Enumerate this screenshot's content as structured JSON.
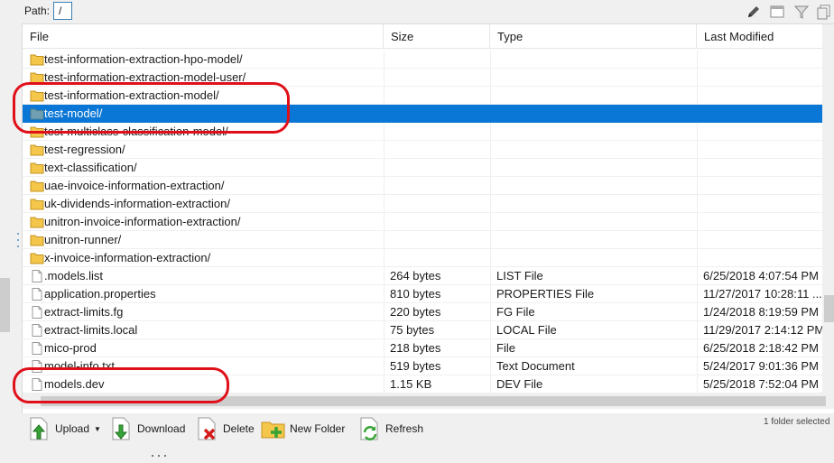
{
  "path_bar": {
    "label": "Path:",
    "value": "/",
    "icons": [
      "pencil-icon",
      "window-icon",
      "filter-icon",
      "copy-icon"
    ]
  },
  "columns": [
    "File",
    "Size",
    "Type",
    "Last Modified"
  ],
  "rows": [
    {
      "name": "test-information-extraction-hpo-model/",
      "size": "",
      "type": "",
      "modified": "",
      "kind": "folder",
      "selected": false
    },
    {
      "name": "test-information-extraction-model-user/",
      "size": "",
      "type": "",
      "modified": "",
      "kind": "folder",
      "selected": false
    },
    {
      "name": "test-information-extraction-model/",
      "size": "",
      "type": "",
      "modified": "",
      "kind": "folder",
      "selected": false
    },
    {
      "name": "test-model/",
      "size": "",
      "type": "",
      "modified": "",
      "kind": "folder",
      "selected": true
    },
    {
      "name": "test-multiclass-classification-model/",
      "size": "",
      "type": "",
      "modified": "",
      "kind": "folder",
      "selected": false
    },
    {
      "name": "test-regression/",
      "size": "",
      "type": "",
      "modified": "",
      "kind": "folder",
      "selected": false
    },
    {
      "name": "text-classification/",
      "size": "",
      "type": "",
      "modified": "",
      "kind": "folder",
      "selected": false
    },
    {
      "name": "uae-invoice-information-extraction/",
      "size": "",
      "type": "",
      "modified": "",
      "kind": "folder",
      "selected": false
    },
    {
      "name": "uk-dividends-information-extraction/",
      "size": "",
      "type": "",
      "modified": "",
      "kind": "folder",
      "selected": false
    },
    {
      "name": "unitron-invoice-information-extraction/",
      "size": "",
      "type": "",
      "modified": "",
      "kind": "folder",
      "selected": false
    },
    {
      "name": "unitron-runner/",
      "size": "",
      "type": "",
      "modified": "",
      "kind": "folder",
      "selected": false
    },
    {
      "name": "x-invoice-information-extraction/",
      "size": "",
      "type": "",
      "modified": "",
      "kind": "folder",
      "selected": false
    },
    {
      "name": ".models.list",
      "size": "264 bytes",
      "type": "LIST File",
      "modified": "6/25/2018 4:07:54 PM",
      "kind": "file",
      "selected": false
    },
    {
      "name": "application.properties",
      "size": "810 bytes",
      "type": "PROPERTIES File",
      "modified": "11/27/2017 10:28:11 ...",
      "kind": "file",
      "selected": false
    },
    {
      "name": "extract-limits.fg",
      "size": "220 bytes",
      "type": "FG File",
      "modified": "1/24/2018 8:19:59 PM",
      "kind": "file",
      "selected": false
    },
    {
      "name": "extract-limits.local",
      "size": "75 bytes",
      "type": "LOCAL File",
      "modified": "11/29/2017 2:14:12 PM",
      "kind": "file",
      "selected": false
    },
    {
      "name": "mico-prod",
      "size": "218 bytes",
      "type": "File",
      "modified": "6/25/2018 2:18:42 PM",
      "kind": "file",
      "selected": false
    },
    {
      "name": "model-info.txt",
      "size": "519 bytes",
      "type": "Text Document",
      "modified": "5/24/2017 9:01:36 PM",
      "kind": "file",
      "selected": false
    },
    {
      "name": "models.dev",
      "size": "1.15 KB",
      "type": "DEV File",
      "modified": "5/25/2018 7:52:04 PM",
      "kind": "file",
      "selected": false
    }
  ],
  "toolbar": {
    "upload": "Upload",
    "download": "Download",
    "delete": "Delete",
    "new_folder": "New Folder",
    "refresh": "Refresh",
    "status": "1 folder selected"
  },
  "colors": {
    "selection": "#0a76d6",
    "annotation": "#e0101a",
    "folder": "#f4c64a"
  }
}
